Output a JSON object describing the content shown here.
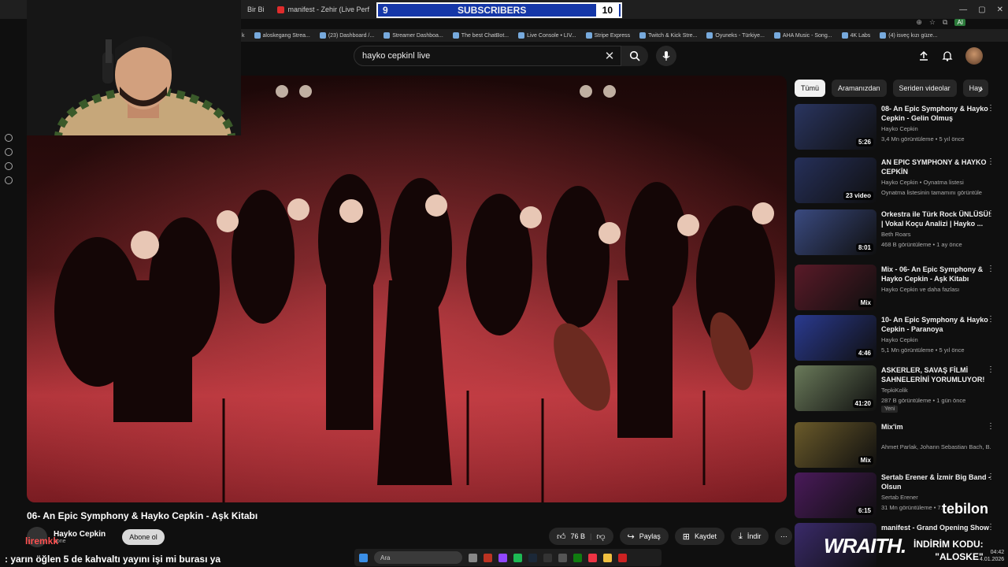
{
  "browser": {
    "tabs": [
      {
        "label": "Bir Bi"
      },
      {
        "label": "manifest - Zehir (Live Perf"
      }
    ],
    "new_tab": "+",
    "window_controls": {
      "minimize": "—",
      "maximize": "▢",
      "close": "✕"
    },
    "address_icons": {
      "ai_badge": "AI"
    },
    "bookmarks": [
      {
        "label": "k"
      },
      {
        "label": "aloskegang Strea..."
      },
      {
        "label": "(23) Dashboard /..."
      },
      {
        "label": "Streamer Dashboa..."
      },
      {
        "label": "The best ChatBot..."
      },
      {
        "label": "Live Console • LIV..."
      },
      {
        "label": "Stripe Express"
      },
      {
        "label": "Twitch & Kick Stre..."
      },
      {
        "label": "Oyuneks - Türkiye..."
      },
      {
        "label": "AHA Music - Song..."
      },
      {
        "label": "4K Labs"
      },
      {
        "label": "(4) isveç kızı güze..."
      }
    ]
  },
  "subscriber_goal": {
    "current": "9",
    "label": "SUBSCRIBERS",
    "target": "10"
  },
  "search": {
    "query": "hayko cepkinl live"
  },
  "video": {
    "title": "06- An Epic Symphony & Hayko Cepkin - Aşk Kitabı",
    "channel": "Hayko Cepkin",
    "subscribers": "bone",
    "subscribe_label": "Abone ol",
    "actions": {
      "likes": "76 B",
      "share": "Paylaş",
      "save": "Kaydet",
      "download": "İndir"
    }
  },
  "filters": [
    "Tümü",
    "Aramanızdan",
    "Seriden videolar",
    "Hay"
  ],
  "recommendations": [
    {
      "title": "08- An Epic Symphony & Hayko Cepkin - Gelin Olmuş",
      "channel": "Hayko Cepkin",
      "meta": "3,4 Mn görüntüleme • 5 yıl önce",
      "duration": "5:26",
      "thumb_color": "#2a3560"
    },
    {
      "title": "AN EPIC SYMPHONY & HAYKO CEPKİN",
      "channel": "Hayko Cepkin • Oynatma listesi",
      "meta": "Oynatma listesinin tamamını görüntüle",
      "duration": "23 video",
      "thumb_color": "#26305a"
    },
    {
      "title": "Orkestra ile Türk Rock ÜNLÜSÜ! | Vokal Koçu Analizi | Hayko ...",
      "channel": "Beth Roars",
      "meta": "468 B görüntüleme • 1 ay önce",
      "duration": "8:01",
      "thumb_color": "#3a4a80"
    },
    {
      "title": "Mix - 06- An Epic Symphony & Hayko Cepkin - Aşk Kitabı",
      "channel": "Hayko Cepkin ve daha fazlası",
      "meta": "",
      "duration": "Mix",
      "thumb_color": "#5a1a28"
    },
    {
      "title": "10- An Epic Symphony & Hayko Cepkin - Paranoya",
      "channel": "Hayko Cepkin",
      "meta": "5,1 Mn görüntüleme • 5 yıl önce",
      "duration": "4:46",
      "thumb_color": "#2a3a90"
    },
    {
      "title": "ASKERLER, SAVAŞ FİLMİ SAHNELERİNİ YORUMLUYOR!",
      "channel": "TepkiKolik",
      "meta": "287 B görüntüleme • 1 gün önce",
      "duration": "41:20",
      "badge": "Yeni",
      "thumb_color": "#6a7a5a"
    },
    {
      "title": "Mix'im",
      "channel": "Ahmet Parlak, Johann Sebastian Bach, B...",
      "meta": "",
      "duration": "Mix",
      "thumb_color": "#6a5a2a"
    },
    {
      "title": "Sertab Erener & İzmir Big Band - Olsun",
      "channel": "Sertab Erener",
      "meta": "31 Mn görüntüleme • 7...",
      "duration": "6:15",
      "thumb_color": "#4a1a5a"
    },
    {
      "title": "manifest - Grand Opening Show",
      "channel": "",
      "meta": "",
      "duration": "",
      "thumb_color": "#3a2a6a"
    }
  ],
  "overlay": {
    "chat_user": "liremkk",
    "chat_message": ": yarın öğlen 5 de kahvaltı yayını işi mi burası ya",
    "taskbar_search": "Ara",
    "clock_time": "04:42",
    "clock_date": "4.01.2026",
    "sponsor_brand": "WRAITH.",
    "sponsor_line1": "İNDİRİM KODU:",
    "sponsor_line2": "\"ALOSKE\"",
    "sponsor_tebilon": "tebilon"
  },
  "colors": {
    "accent": "#ff0000",
    "sub_goal_bar": "#1537a8"
  }
}
